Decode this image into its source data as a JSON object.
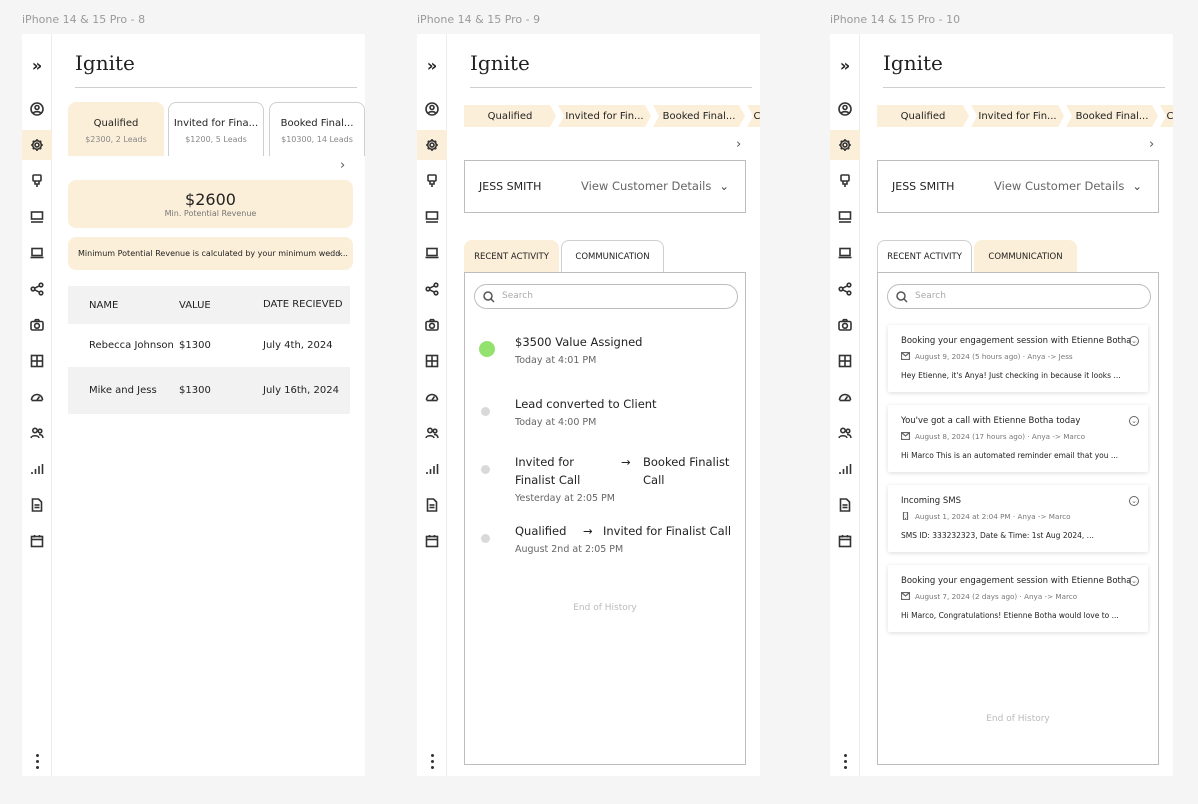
{
  "frames": [
    {
      "label": "iPhone 14 & 15 Pro - 8"
    },
    {
      "label": "iPhone 14 & 15 Pro - 9"
    },
    {
      "label": "iPhone 14 & 15 Pro - 10"
    }
  ],
  "brand": "Ignite",
  "rail_icons": [
    "expand-icon",
    "user-icon",
    "gear-icon",
    "brush-icon",
    "monitor-icon",
    "laptop-icon",
    "share-icon",
    "camera-icon",
    "grid-icon",
    "speedometer-icon",
    "users-icon",
    "bar-chart-icon",
    "document-icon",
    "calendar-icon",
    "more-icon"
  ],
  "accent": "#fcefd9",
  "screen8": {
    "stages": [
      {
        "title": "Qualified",
        "sub": "$2300, 2 Leads"
      },
      {
        "title": "Invited for Fina...",
        "sub": "$1200, 5 Leads"
      },
      {
        "title": "Booked Final...",
        "sub": "$10300, 14 Leads"
      }
    ],
    "revenue": {
      "value": "$2600",
      "label": "Min. Potential Revenue"
    },
    "info": "Minimum Potential Revenue is calculated by your minimum wedd...",
    "table": {
      "headers": [
        "NAME",
        "VALUE",
        "DATE RECIEVED"
      ],
      "rows": [
        [
          "Rebecca Johnson",
          "$1300",
          "July 4th, 2024"
        ],
        [
          "Mike and Jess",
          "$1300",
          "July 16th, 2024"
        ]
      ]
    }
  },
  "stage_chips": [
    "Qualified",
    "Invited for Fin...",
    "Booked Final...",
    "C"
  ],
  "customer": {
    "name": "JESS SMITH",
    "view_label": "View Customer Details"
  },
  "tabs": {
    "recent": "RECENT ACTIVITY",
    "communication": "COMMUNICATION"
  },
  "search_placeholder": "Search",
  "end_of_history": "End of History",
  "activities": [
    {
      "title": "$3500 Value Assigned",
      "time": "Today at 4:01 PM"
    },
    {
      "title": "Lead converted to Client",
      "time": "Today at 4:00 PM"
    },
    {
      "from": "Invited for Finalist Call",
      "to": "Booked Finalist Call",
      "time": "Yesterday at 2:05 PM"
    },
    {
      "from": "Qualified",
      "to": "Invited for Finalist Call",
      "time": "August 2nd at 2:05 PM"
    }
  ],
  "messages": [
    {
      "title": "Booking your engagement session with Etienne Botha",
      "meta": "August 9, 2024 (5 hours ago) · Anya -> Jess",
      "body": "Hey Etienne, it's Anya! Just checking in because it looks ...",
      "icon": "mail-icon"
    },
    {
      "title": "You've got a call with Etienne Botha today",
      "meta": "August 8, 2024 (17 hours ago) · Anya -> Marco",
      "body": "Hi Marco This is an automated reminder email that you ...",
      "icon": "mail-icon"
    },
    {
      "title": "Incoming SMS",
      "meta": "August 1, 2024 at 2:04 PM · Anya -> Marco",
      "body": "SMS ID: 333232323, Date & Time: 1st Aug 2024, ...",
      "icon": "phone-icon"
    },
    {
      "title": "Booking your engagement session with Etienne Botha",
      "meta": "August 7, 2024 (2 days ago) · Anya -> Marco",
      "body": "Hi Marco, Congratulations! Etienne Botha would love to ...",
      "icon": "mail-icon"
    }
  ]
}
